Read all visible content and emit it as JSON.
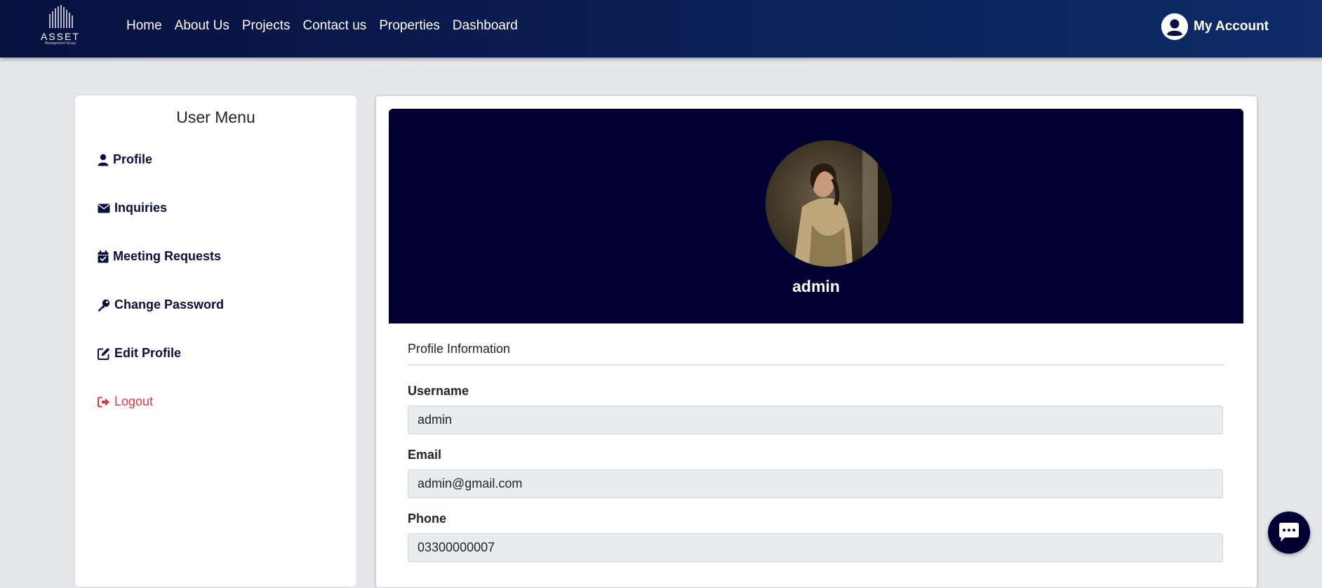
{
  "brand": {
    "logo_text": "ASSET",
    "logo_subtext": "Management Group"
  },
  "nav": {
    "links": [
      {
        "label": "Home"
      },
      {
        "label": "About Us"
      },
      {
        "label": "Projects"
      },
      {
        "label": "Contact us"
      },
      {
        "label": "Properties"
      },
      {
        "label": "Dashboard"
      }
    ],
    "account_label": "My Account"
  },
  "sidebar": {
    "title": "User Menu",
    "items": [
      {
        "label": "Profile",
        "icon": "user-icon"
      },
      {
        "label": "Inquiries",
        "icon": "envelope-icon"
      },
      {
        "label": "Meeting Requests",
        "icon": "calendar-check-icon"
      },
      {
        "label": "Change Password",
        "icon": "key-icon"
      },
      {
        "label": "Edit Profile",
        "icon": "edit-icon"
      },
      {
        "label": "Logout",
        "icon": "sign-out-icon"
      }
    ]
  },
  "profile": {
    "name": "admin",
    "section_title": "Profile Information",
    "fields": [
      {
        "label": "Username",
        "value": "admin"
      },
      {
        "label": "Email",
        "value": "admin@gmail.com"
      },
      {
        "label": "Phone",
        "value": "03300000007"
      }
    ]
  },
  "colors": {
    "nav_dark": "#07103f",
    "banner": "#000033",
    "link": "#07103f",
    "logout": "#dc3545",
    "input_bg": "#e9ecef",
    "page_bg": "#e5e7ea"
  },
  "chat": {
    "icon": "chat-bubble-icon"
  }
}
